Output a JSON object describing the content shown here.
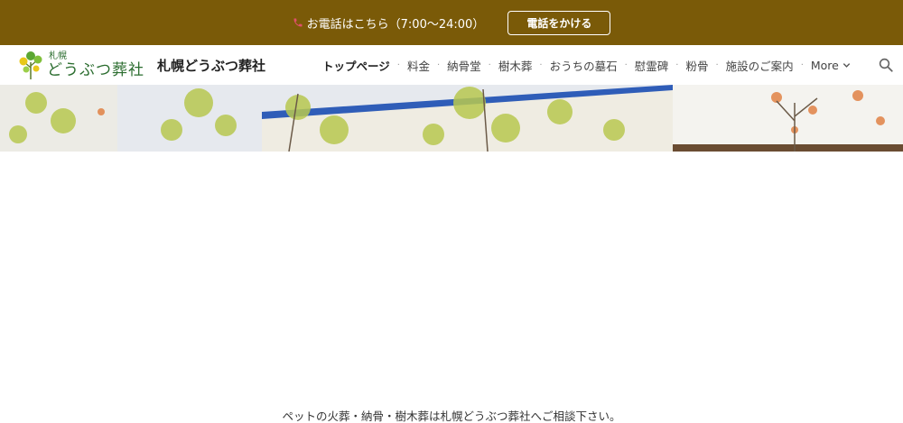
{
  "topbar": {
    "phone_text": "お電話はこちら（7:00〜24:00）",
    "call_button": "電話をかける",
    "phone_icon": "phone-icon",
    "bg_color": "#7a5a08"
  },
  "header": {
    "logo_small": "札幌",
    "logo_big": "どうぶつ葬社",
    "site_title": "札幌どうぶつ葬社",
    "nav": [
      {
        "label": "トップページ",
        "active": true
      },
      {
        "label": "料金"
      },
      {
        "label": "納骨堂"
      },
      {
        "label": "樹木葬"
      },
      {
        "label": "おうちの墓石"
      },
      {
        "label": "慰霊碑"
      },
      {
        "label": "粉骨"
      },
      {
        "label": "施設のご案内"
      }
    ],
    "more_label": "More",
    "search_icon": "search-icon"
  },
  "footer_tagline": "ペットの火葬・納骨・樹木葬は札幌どうぶつ葬社へご相談下さい。"
}
